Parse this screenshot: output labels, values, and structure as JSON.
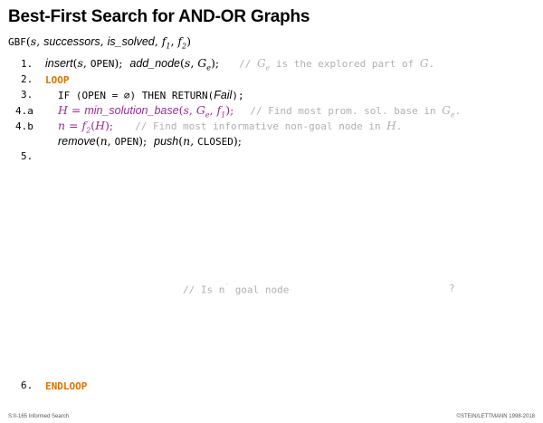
{
  "title": "Best-First Search for AND-OR Graphs",
  "signature": {
    "name": "GBF",
    "args": [
      "s",
      "successors",
      "is_solved",
      "f",
      "f"
    ],
    "sub1": "1",
    "sub2": "2"
  },
  "lines": [
    {
      "num": "1.",
      "code": [
        {
          "t": "insert",
          "cls": "sans-it"
        },
        {
          "t": "(s, ",
          "cls": "it"
        },
        {
          "t": "OPEN",
          "cls": "mono"
        },
        {
          "t": ");  ",
          "cls": ""
        },
        {
          "t": "add_node",
          "cls": "sans-it"
        },
        {
          "t": "(s, G",
          "cls": "it"
        },
        {
          "t": "e",
          "cls": "it sub"
        },
        {
          "t": ");",
          "cls": ""
        }
      ],
      "comment": "// G",
      "comment_sub": "e",
      "comment_rest": " is the explored part of G."
    },
    {
      "num": "2.",
      "keyword": "LOOP"
    },
    {
      "num": "3.",
      "text": "IF (OPEN = ∅) THEN RETURN(",
      "fail": "Fail",
      "text_end": ");"
    },
    {
      "num": "4.a",
      "code_purple": "H = min_solution_base(s, G",
      "code_purple_sub": "e",
      "code_purple_end": ", f",
      "code_purple_sub2": "1",
      "code_purple_close": ");",
      "comment": "// Find most prom. sol. base in G",
      "comment_sub": "e",
      "comment_rest": "."
    },
    {
      "num": "4.b",
      "code_purple": "n = f",
      "code_purple_sub": "2",
      "code_purple_end": "(H);",
      "comment": "// Find most informative non-goal node in H."
    },
    {
      "num": "",
      "cont": "remove(n, OPEN);  push(n, CLOSED);"
    },
    {
      "num": "5.",
      "text": ""
    },
    {
      "num": "6.",
      "keyword": "ENDLOOP"
    }
  ],
  "mid_comment": {
    "prefix": "// Is n",
    "prime": "′",
    "suffix": " goal node",
    "tail": "?"
  },
  "footer": {
    "left": "S:II-165   Informed Search",
    "right": "©STEIN/LETTMANN 1998-2018"
  }
}
